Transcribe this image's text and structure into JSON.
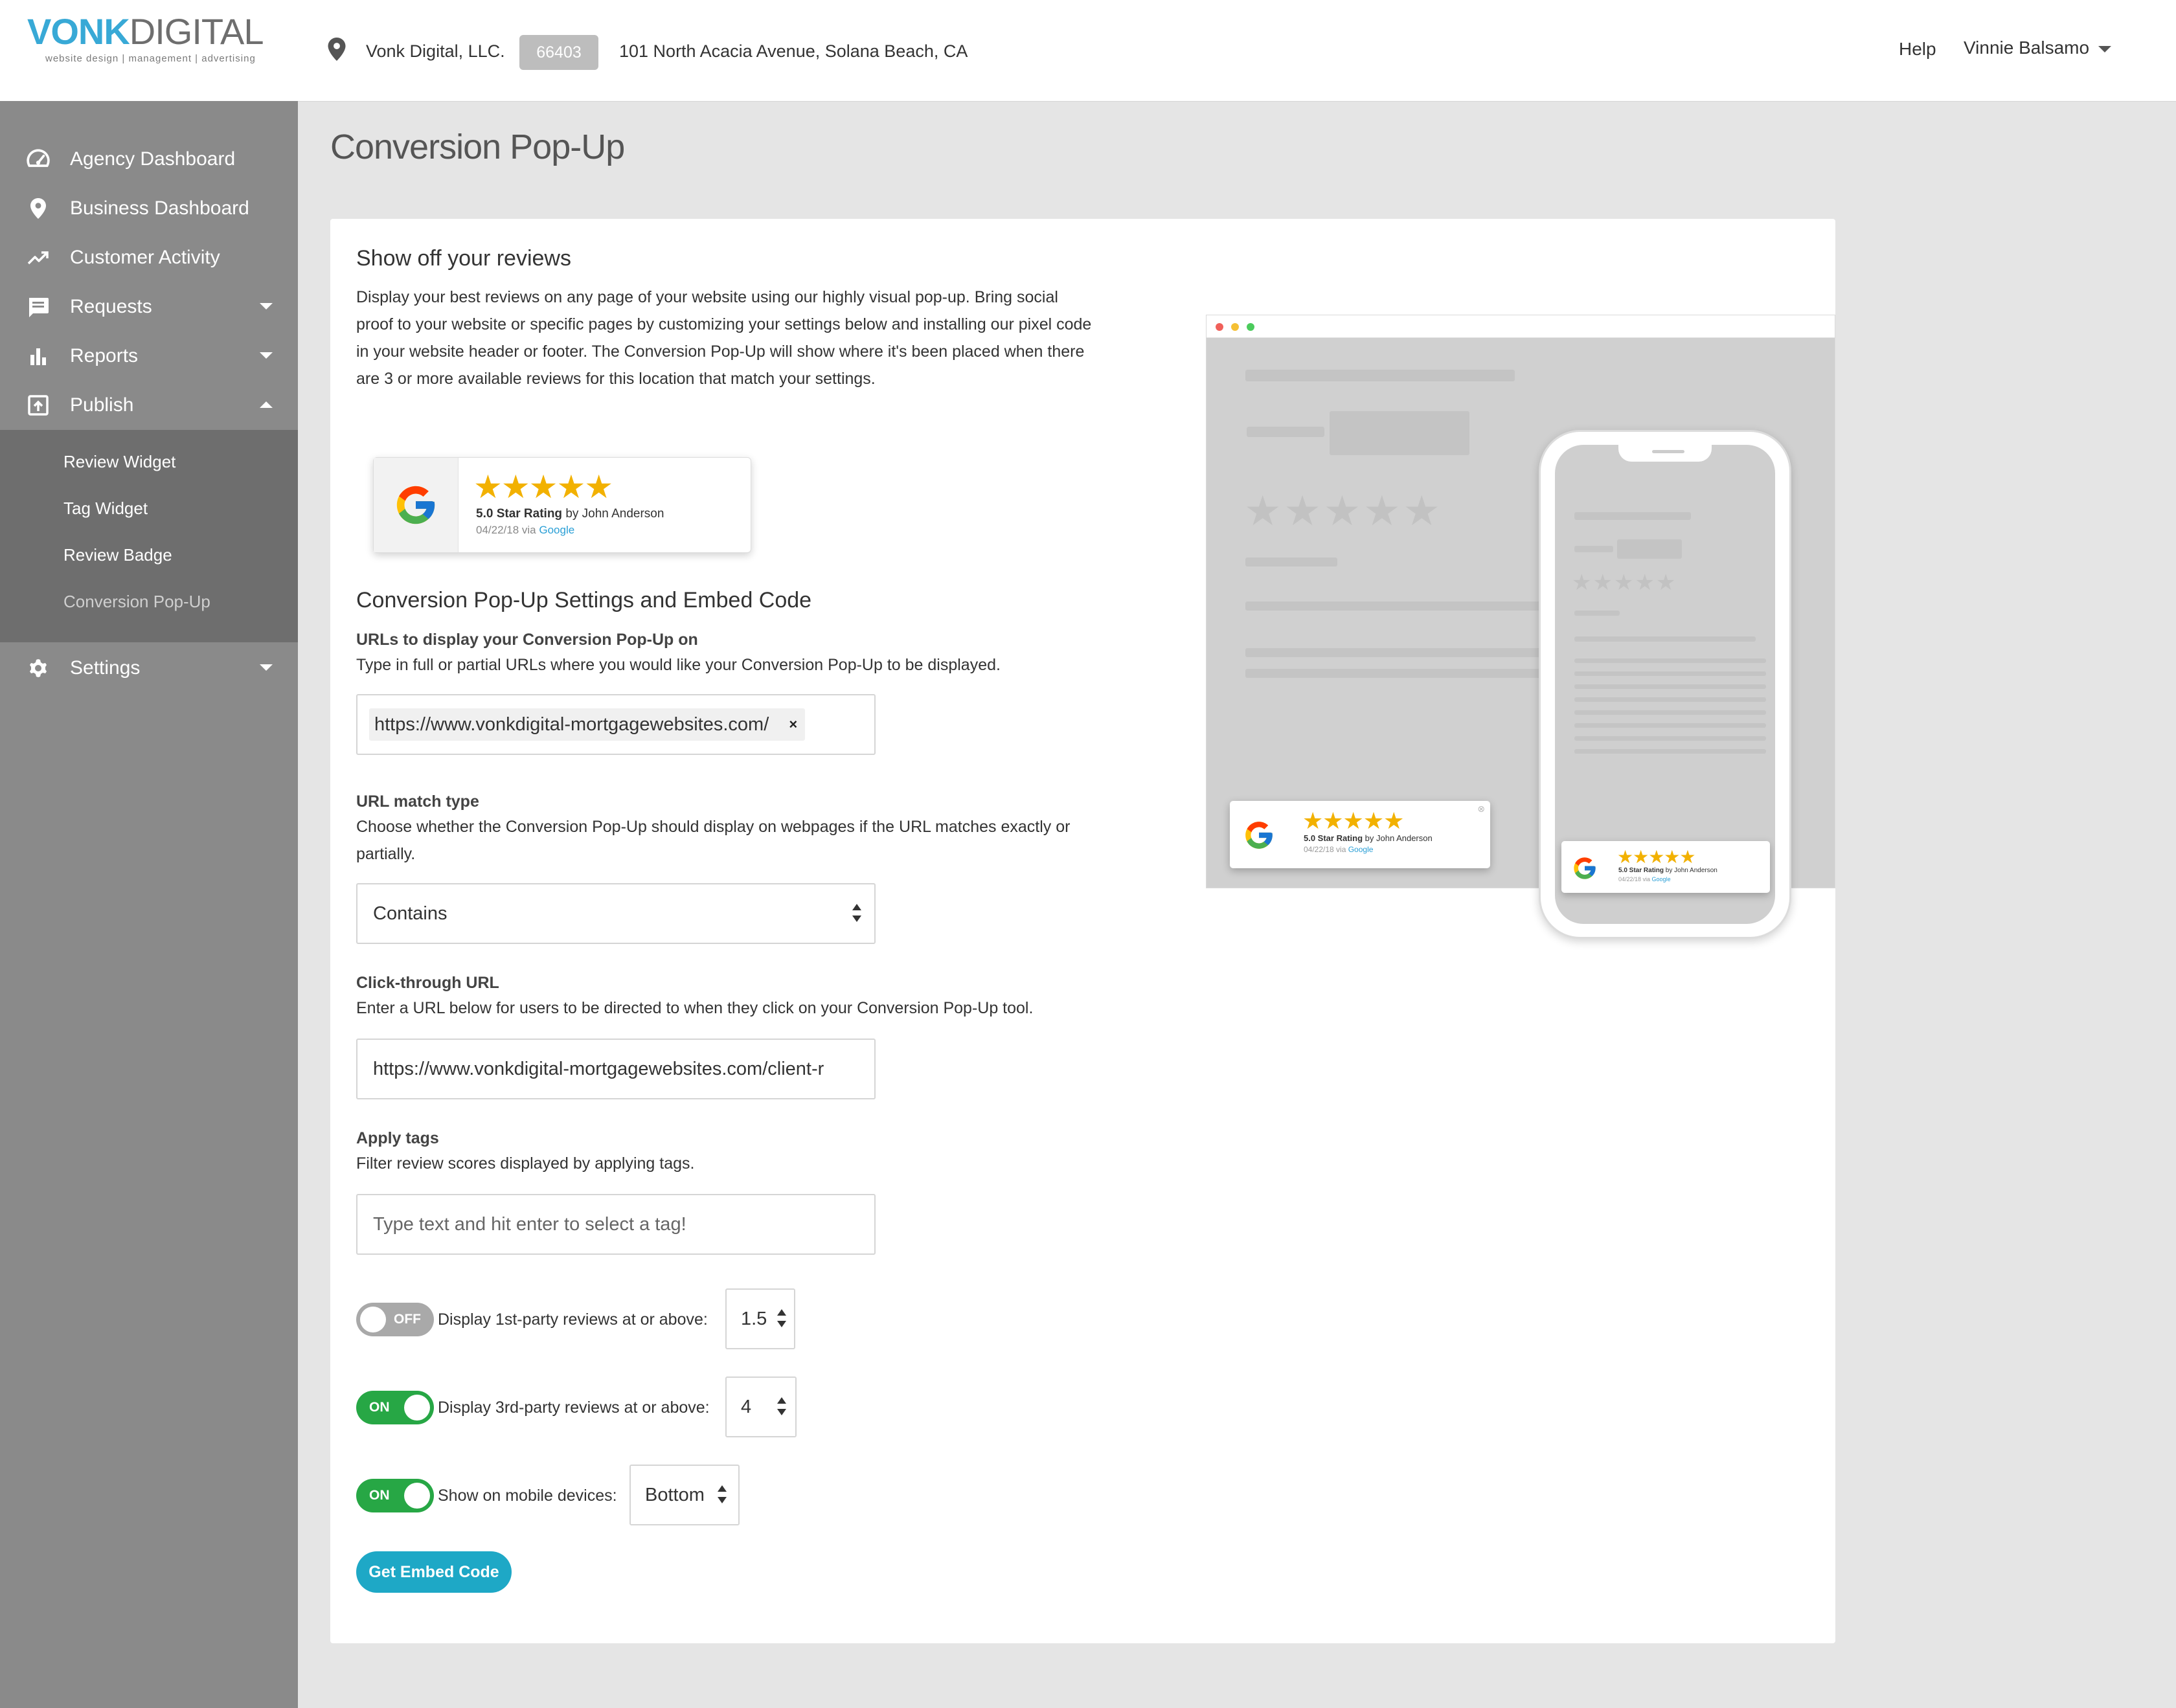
{
  "brand": {
    "logo_primary": "VONK",
    "logo_secondary": "DIGITAL",
    "tagline": "website design | management | advertising",
    "accent_color": "#38a9d6"
  },
  "header": {
    "business_name": "Vonk Digital, LLC.",
    "business_id": "66403",
    "business_address": "101 North Acacia Avenue, Solana Beach, CA",
    "help_label": "Help",
    "user_name": "Vinnie Balsamo"
  },
  "sidebar": {
    "items": [
      {
        "label": "Agency Dashboard",
        "icon": "speedometer-icon"
      },
      {
        "label": "Business Dashboard",
        "icon": "map-pin-icon"
      },
      {
        "label": "Customer Activity",
        "icon": "trending-up-icon"
      },
      {
        "label": "Requests",
        "icon": "message-icon"
      },
      {
        "label": "Reports",
        "icon": "bar-chart-icon"
      },
      {
        "label": "Publish",
        "icon": "publish-icon"
      },
      {
        "label": "Settings",
        "icon": "gear-icon"
      }
    ],
    "publish_sub": [
      {
        "label": "Review Widget"
      },
      {
        "label": "Tag Widget"
      },
      {
        "label": "Review Badge"
      },
      {
        "label": "Conversion Pop-Up",
        "active": true
      }
    ]
  },
  "page": {
    "title": "Conversion Pop-Up",
    "show_off_title": "Show off your reviews",
    "intro": "Display your best reviews on any page of your website using our highly visual pop-up. Bring social proof to your website or specific pages by customizing your settings below and installing our pixel code in your website header or footer. The Conversion Pop-Up will show where it's been placed when there are 3 or more available reviews for this location that match your settings.",
    "sample": {
      "stars": "★★★★★",
      "rating_bold": "5.0 Star Rating",
      "rating_by": " by John Anderson",
      "date": "04/22/18 via ",
      "source": "Google"
    },
    "settings_title": "Conversion Pop-Up Settings and Embed Code",
    "urls": {
      "label": "URLs to display your Conversion Pop-Up on",
      "help": "Type in full or partial URLs where you would like your Conversion Pop-Up to be displayed.",
      "chip": "https://www.vonkdigital-mortgagewebsites.com/",
      "chip_remove": "×"
    },
    "match": {
      "label": "URL match type",
      "help": "Choose whether the Conversion Pop-Up should display on webpages if the URL matches exactly or partially.",
      "value": "Contains"
    },
    "clickthrough": {
      "label": "Click-through URL",
      "help": "Enter a URL below for users to be directed to when they click on your Conversion Pop-Up tool.",
      "value": "https://www.vonkdigital-mortgagewebsites.com/client-r"
    },
    "tags": {
      "label": "Apply tags",
      "help": "Filter review scores displayed by applying tags.",
      "placeholder": "Type text and hit enter to select a tag!"
    },
    "toggles": [
      {
        "state": "OFF",
        "label": "Display 1st-party reviews at or above:",
        "value": "1.5"
      },
      {
        "state": "ON",
        "label": "Display 3rd-party reviews at or above:",
        "value": "4"
      },
      {
        "state": "ON",
        "label": "Show on mobile devices:",
        "value": "Bottom"
      }
    ],
    "embed_button": "Get Embed Code"
  },
  "colors": {
    "toggle_on": "#27a745",
    "toggle_off": "#a9a9a9",
    "embed_button": "#1ea8c6",
    "star": "#f2b100"
  }
}
